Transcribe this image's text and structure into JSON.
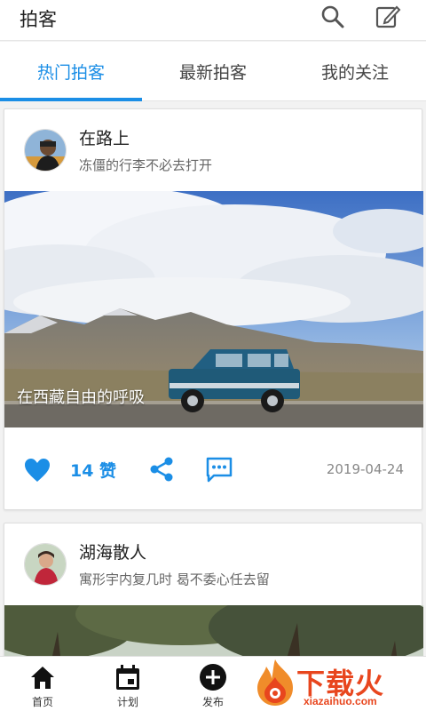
{
  "header": {
    "title": "拍客",
    "search_icon": "search-icon",
    "edit_icon": "edit-icon"
  },
  "tabs": [
    {
      "label": "热门拍客",
      "active": true
    },
    {
      "label": "最新拍客",
      "active": false
    },
    {
      "label": "我的关注",
      "active": false
    }
  ],
  "feed": [
    {
      "username": "在路上",
      "bio": "冻僵的行李不必去打开",
      "photo_caption": "在西藏自由的呼吸",
      "likes": "14 赞",
      "date": "2019-04-24"
    },
    {
      "username": "湖海散人",
      "bio": "寓形宇内复几时 曷不委心任去留"
    }
  ],
  "bottom_nav": [
    {
      "label": "首页",
      "icon": "home-icon"
    },
    {
      "label": "计划",
      "icon": "calendar-icon"
    },
    {
      "label": "发布",
      "icon": "add-circle-icon"
    }
  ],
  "watermark": {
    "text": "下载火",
    "sub": "xiazaihuo.com"
  },
  "colors": {
    "accent": "#1b8ee6",
    "watermark": "#e8461e"
  }
}
